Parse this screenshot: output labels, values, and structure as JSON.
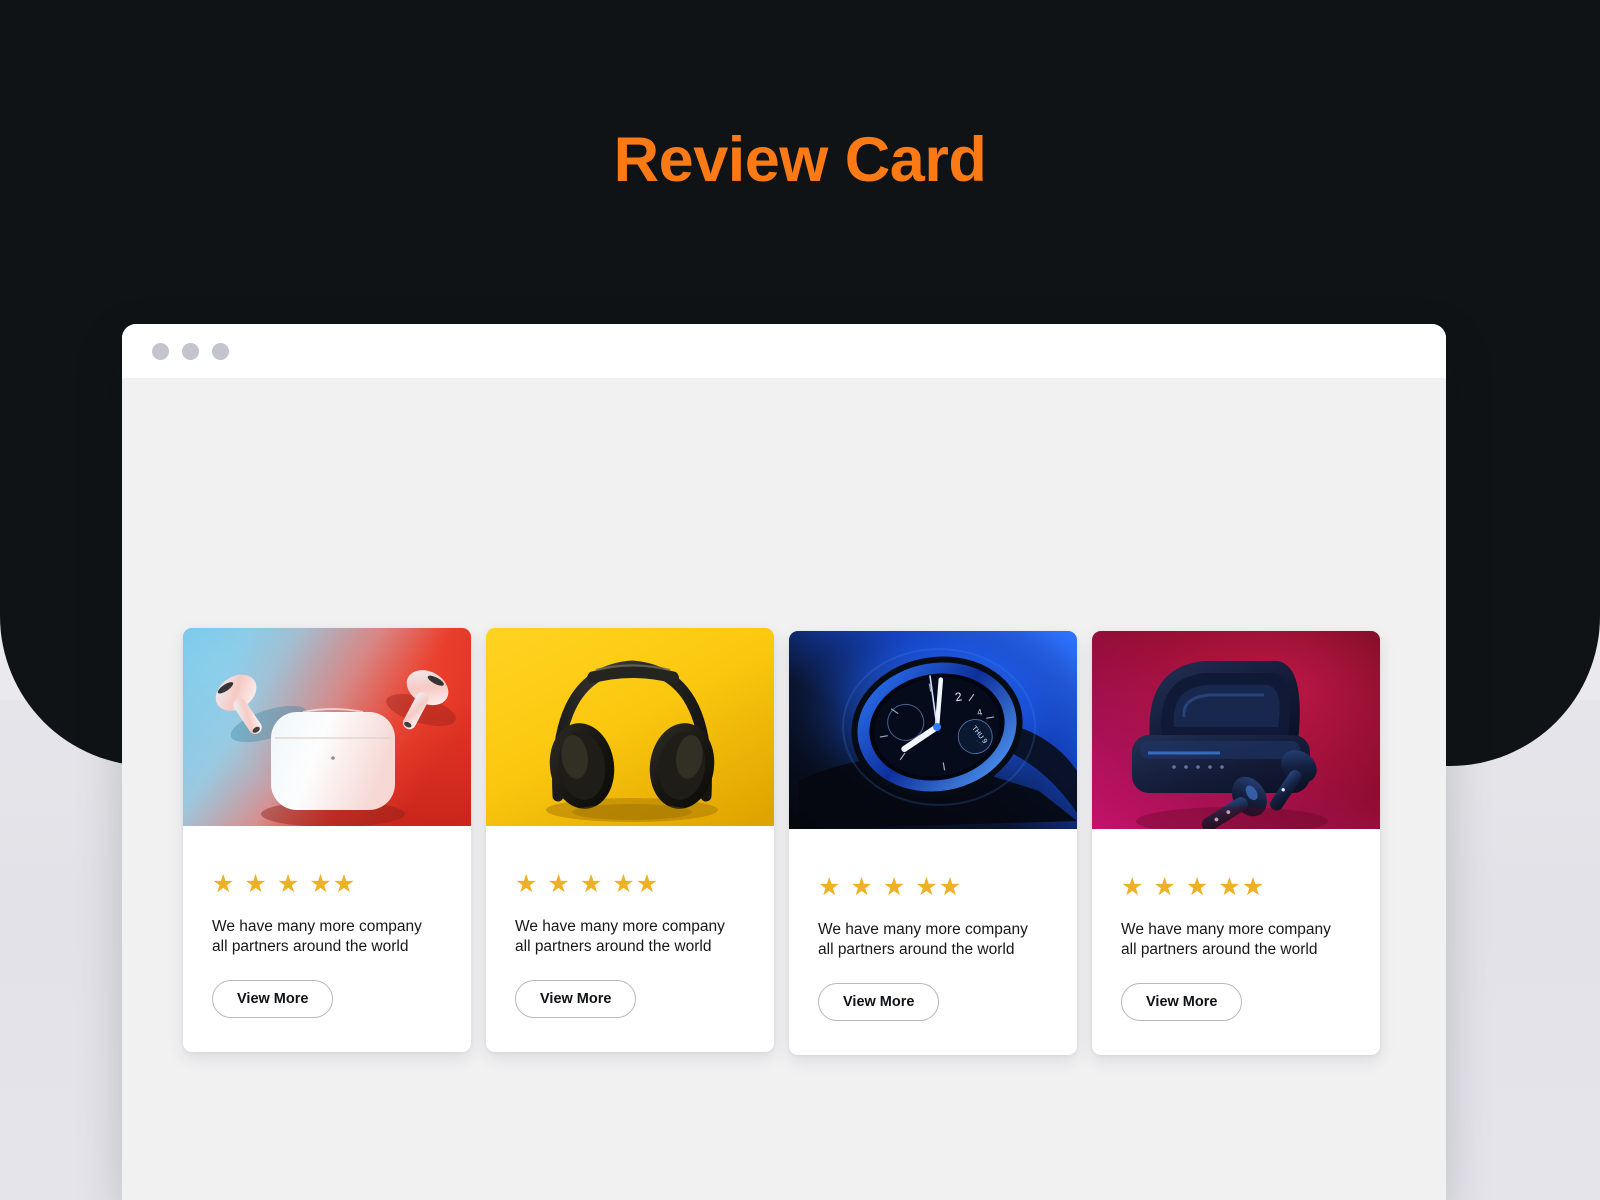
{
  "page": {
    "title": "Review Card",
    "title_color": "#fb7a16",
    "backdrop_color": "#0f1316",
    "under_sheet_color": "#e5e5ea"
  },
  "browser_window": {
    "titlebar_color": "#ffffff",
    "body_color": "#f1f1f2",
    "window_dots": [
      "window-dot-1",
      "window-dot-2",
      "window-dot-3"
    ],
    "dot_color": "#c2c4ce"
  },
  "cards": [
    {
      "image_name": "airpods-pro-with-case-blue-red-gradient",
      "image_alt": "White AirPods Pro earbuds beside charging case on blue to red gradient background",
      "rating": 5,
      "star_glyph": "★",
      "star_color": "#eeb024",
      "review_text": "We have many more company all partners around the world",
      "button_label": "View More"
    },
    {
      "image_name": "black-over-ear-headphones-yellow",
      "image_alt": "Black over-ear headphones on a bright yellow background",
      "rating": 5,
      "star_glyph": "★",
      "star_color": "#eeb024",
      "review_text": "We have many more company all partners around the world",
      "button_label": "View More"
    },
    {
      "image_name": "smartwatch-blue-neon",
      "image_alt": "Close up of a smartwatch face lit with blue neon light on dark background",
      "rating": 5,
      "star_glyph": "★",
      "star_color": "#eeb024",
      "review_text": "We have many more company all partners around the world",
      "button_label": "View More"
    },
    {
      "image_name": "wireless-earbuds-case-red-magenta",
      "image_alt": "Dark wireless earbuds and open charging case on red magenta background",
      "rating": 5,
      "star_glyph": "★",
      "star_color": "#eeb024",
      "review_text": "We have many more company all partners around the world",
      "button_label": "View More"
    }
  ]
}
